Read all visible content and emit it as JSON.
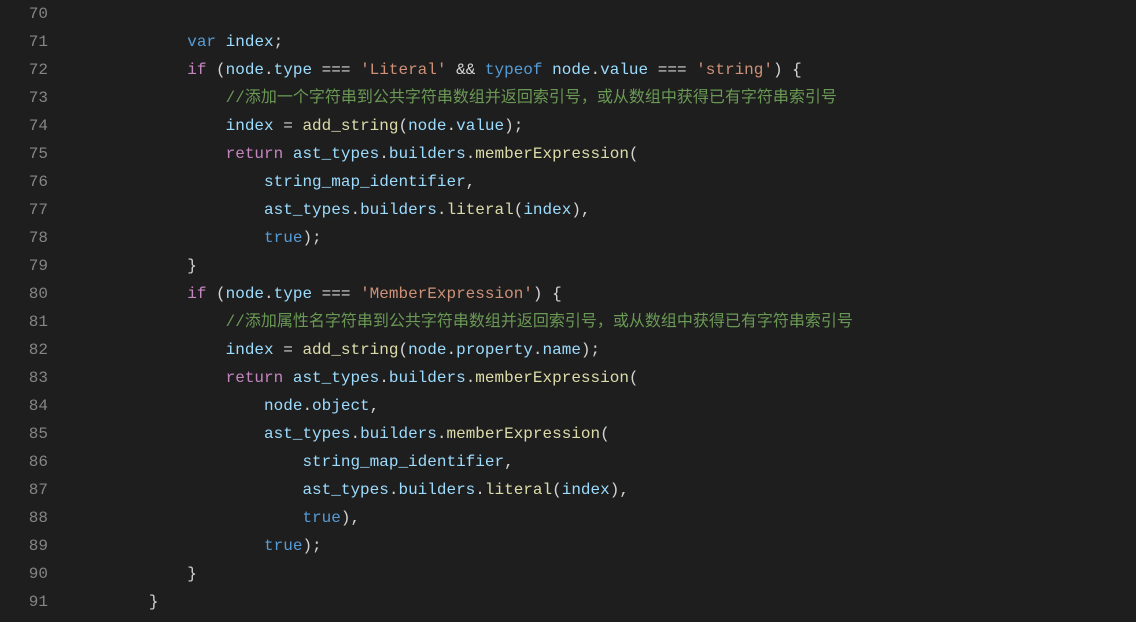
{
  "startLine": 70,
  "lines": [
    {
      "n": 70,
      "indent": 3,
      "tokens": []
    },
    {
      "n": 71,
      "indent": 3,
      "tokens": [
        [
          "k-var",
          "var"
        ],
        [
          "pun",
          " "
        ],
        [
          "ident",
          "index"
        ],
        [
          "pun",
          ";"
        ]
      ]
    },
    {
      "n": 72,
      "indent": 3,
      "tokens": [
        [
          "k-ctrl",
          "if"
        ],
        [
          "pun",
          " ("
        ],
        [
          "ident",
          "node"
        ],
        [
          "pun",
          "."
        ],
        [
          "prop",
          "type"
        ],
        [
          "op",
          " === "
        ],
        [
          "str",
          "'Literal'"
        ],
        [
          "op",
          " && "
        ],
        [
          "k-typeof",
          "typeof"
        ],
        [
          "pun",
          " "
        ],
        [
          "ident",
          "node"
        ],
        [
          "pun",
          "."
        ],
        [
          "prop",
          "value"
        ],
        [
          "op",
          " === "
        ],
        [
          "str",
          "'string'"
        ],
        [
          "pun",
          ") {"
        ]
      ]
    },
    {
      "n": 73,
      "indent": 4,
      "tokens": [
        [
          "cmt",
          "//添加一个字符串到公共字符串数组并返回索引号，或从数组中获得已有字符串索引号"
        ]
      ]
    },
    {
      "n": 74,
      "indent": 4,
      "tokens": [
        [
          "ident",
          "index"
        ],
        [
          "op",
          " = "
        ],
        [
          "call",
          "add_string"
        ],
        [
          "pun",
          "("
        ],
        [
          "ident",
          "node"
        ],
        [
          "pun",
          "."
        ],
        [
          "prop",
          "value"
        ],
        [
          "pun",
          ");"
        ]
      ]
    },
    {
      "n": 75,
      "indent": 4,
      "tokens": [
        [
          "k-ctrl",
          "return"
        ],
        [
          "pun",
          " "
        ],
        [
          "ident",
          "ast_types"
        ],
        [
          "pun",
          "."
        ],
        [
          "prop",
          "builders"
        ],
        [
          "pun",
          "."
        ],
        [
          "call",
          "memberExpression"
        ],
        [
          "pun",
          "("
        ]
      ]
    },
    {
      "n": 76,
      "indent": 5,
      "tokens": [
        [
          "ident",
          "string_map_identifier"
        ],
        [
          "pun",
          ","
        ]
      ]
    },
    {
      "n": 77,
      "indent": 5,
      "tokens": [
        [
          "ident",
          "ast_types"
        ],
        [
          "pun",
          "."
        ],
        [
          "prop",
          "builders"
        ],
        [
          "pun",
          "."
        ],
        [
          "call",
          "literal"
        ],
        [
          "pun",
          "("
        ],
        [
          "ident",
          "index"
        ],
        [
          "pun",
          "),"
        ]
      ]
    },
    {
      "n": 78,
      "indent": 5,
      "tokens": [
        [
          "k-true",
          "true"
        ],
        [
          "pun",
          ");"
        ]
      ]
    },
    {
      "n": 79,
      "indent": 3,
      "tokens": [
        [
          "pun",
          "}"
        ]
      ]
    },
    {
      "n": 80,
      "indent": 3,
      "tokens": [
        [
          "k-ctrl",
          "if"
        ],
        [
          "pun",
          " ("
        ],
        [
          "ident",
          "node"
        ],
        [
          "pun",
          "."
        ],
        [
          "prop",
          "type"
        ],
        [
          "op",
          " === "
        ],
        [
          "str",
          "'MemberExpression'"
        ],
        [
          "pun",
          ") {"
        ]
      ]
    },
    {
      "n": 81,
      "indent": 4,
      "tokens": [
        [
          "cmt",
          "//添加属性名字符串到公共字符串数组并返回索引号，或从数组中获得已有字符串索引号"
        ]
      ]
    },
    {
      "n": 82,
      "indent": 4,
      "tokens": [
        [
          "ident",
          "index"
        ],
        [
          "op",
          " = "
        ],
        [
          "call",
          "add_string"
        ],
        [
          "pun",
          "("
        ],
        [
          "ident",
          "node"
        ],
        [
          "pun",
          "."
        ],
        [
          "prop",
          "property"
        ],
        [
          "pun",
          "."
        ],
        [
          "prop",
          "name"
        ],
        [
          "pun",
          ");"
        ]
      ]
    },
    {
      "n": 83,
      "indent": 4,
      "tokens": [
        [
          "k-ctrl",
          "return"
        ],
        [
          "pun",
          " "
        ],
        [
          "ident",
          "ast_types"
        ],
        [
          "pun",
          "."
        ],
        [
          "prop",
          "builders"
        ],
        [
          "pun",
          "."
        ],
        [
          "call",
          "memberExpression"
        ],
        [
          "pun",
          "("
        ]
      ]
    },
    {
      "n": 84,
      "indent": 5,
      "tokens": [
        [
          "ident",
          "node"
        ],
        [
          "pun",
          "."
        ],
        [
          "prop",
          "object"
        ],
        [
          "pun",
          ","
        ]
      ]
    },
    {
      "n": 85,
      "indent": 5,
      "tokens": [
        [
          "ident",
          "ast_types"
        ],
        [
          "pun",
          "."
        ],
        [
          "prop",
          "builders"
        ],
        [
          "pun",
          "."
        ],
        [
          "call",
          "memberExpression"
        ],
        [
          "pun",
          "("
        ]
      ]
    },
    {
      "n": 86,
      "indent": 6,
      "tokens": [
        [
          "ident",
          "string_map_identifier"
        ],
        [
          "pun",
          ","
        ]
      ]
    },
    {
      "n": 87,
      "indent": 6,
      "tokens": [
        [
          "ident",
          "ast_types"
        ],
        [
          "pun",
          "."
        ],
        [
          "prop",
          "builders"
        ],
        [
          "pun",
          "."
        ],
        [
          "call",
          "literal"
        ],
        [
          "pun",
          "("
        ],
        [
          "ident",
          "index"
        ],
        [
          "pun",
          "),"
        ]
      ]
    },
    {
      "n": 88,
      "indent": 6,
      "tokens": [
        [
          "k-true",
          "true"
        ],
        [
          "pun",
          "),"
        ]
      ]
    },
    {
      "n": 89,
      "indent": 5,
      "tokens": [
        [
          "k-true",
          "true"
        ],
        [
          "pun",
          ");"
        ]
      ]
    },
    {
      "n": 90,
      "indent": 3,
      "tokens": [
        [
          "pun",
          "}"
        ]
      ]
    },
    {
      "n": 91,
      "indent": 2,
      "tokens": [
        [
          "pun",
          "}"
        ]
      ]
    }
  ],
  "indentUnit": "    "
}
